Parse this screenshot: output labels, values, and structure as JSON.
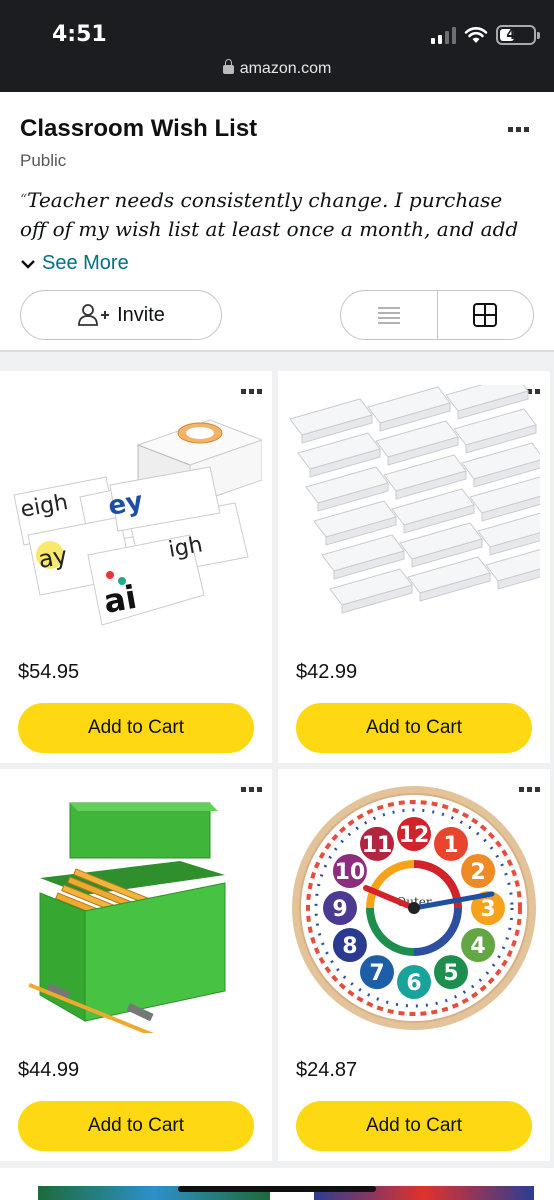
{
  "status": {
    "time": "4:51",
    "battery": "45",
    "battery_level": 0.45
  },
  "browser": {
    "url": "amazon.com"
  },
  "list": {
    "title": "Classroom Wish List",
    "visibility": "Public",
    "description_quote": "“",
    "description": "Teacher needs consistently change. I purchase off of my wish list at least once a month, and add to it at",
    "see_more": "See More",
    "invite": "Invite"
  },
  "view_toggle": {
    "options": [
      "list-view-icon",
      "grid-view-icon"
    ],
    "selected": "grid-view-icon"
  },
  "items": [
    {
      "price": "$54.95",
      "cta": "Add to Cart",
      "image": "phonics-flash-cards"
    },
    {
      "price": "$42.99",
      "cta": "Add to Cart",
      "image": "acrylic-name-plates"
    },
    {
      "price": "$44.99",
      "cta": "Add to Cart",
      "image": "green-pencil-box"
    },
    {
      "price": "$24.87",
      "cta": "Add to Cart",
      "image": "teaching-clock"
    }
  ],
  "colors": {
    "cta": "#ffd814",
    "link": "#007185",
    "topbar": "#1b1d20"
  },
  "clock": {
    "hours": [
      "12",
      "1",
      "2",
      "3",
      "4",
      "5",
      "6",
      "7",
      "8",
      "9",
      "10",
      "11"
    ],
    "hour_colors": [
      "#d2232a",
      "#e8452c",
      "#f08a24",
      "#f6a21b",
      "#62a744",
      "#1e8e4e",
      "#1aa39a",
      "#1d5fa7",
      "#2a3b8f",
      "#4b3a91",
      "#8e2c7e",
      "#b3243f"
    ],
    "brand": "Outer"
  }
}
